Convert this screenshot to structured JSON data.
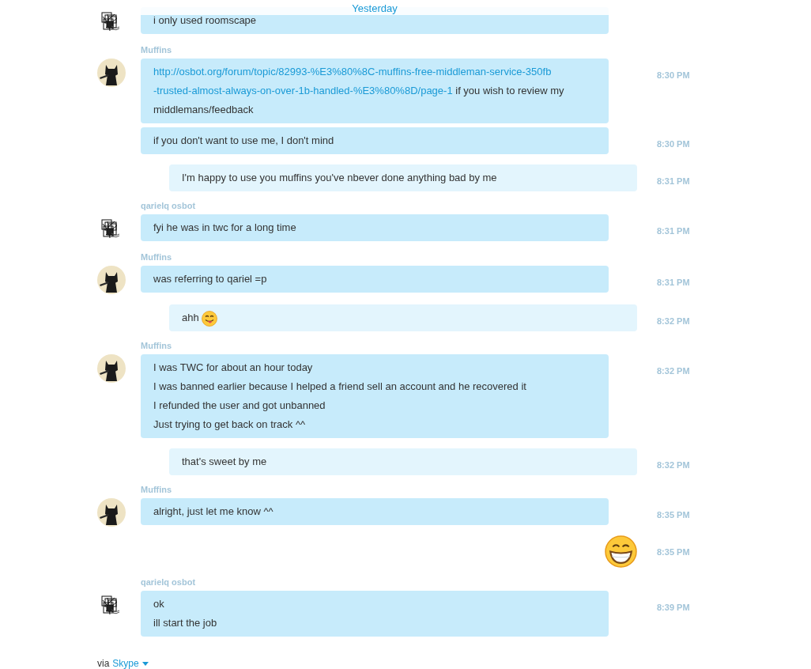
{
  "header": {
    "label": "Yesterday"
  },
  "groups": [
    {
      "kind": "incoming",
      "avatar": {
        "kind": "scribble"
      },
      "messages": [
        {
          "lines": [
            "i only used roomscape"
          ]
        }
      ]
    },
    {
      "kind": "incoming",
      "sender": "Muffins",
      "avatar": {
        "kind": "cat"
      },
      "messages": [
        {
          "lines": [
            [
              {
                "kind": "link",
                "text": "http://osbot.org/forum/topic/82993-%E3%80%8C-muffins-free-middleman-service-350fb"
              }
            ],
            [
              {
                "kind": "link",
                "text": "-trusted-almost-always-on-over-1b-handled-%E3%80%8D/page-1"
              },
              {
                "kind": "text",
                "text": " if you wish to review my"
              }
            ],
            "middlemans/feedback"
          ],
          "time": "8:30 PM"
        },
        {
          "lines": [
            "if you don't want to use me, I don't mind"
          ],
          "time": "8:30 PM"
        }
      ]
    },
    {
      "kind": "outgoing",
      "lines": [
        "I'm happy to use you muffins you've nbever done anything bad by me"
      ],
      "time": "8:31 PM"
    },
    {
      "kind": "incoming",
      "sender": "qarielq osbot",
      "avatar": {
        "kind": "scribble"
      },
      "messages": [
        {
          "lines": [
            "fyi he was in twc for a long time"
          ],
          "time": "8:31 PM"
        }
      ]
    },
    {
      "kind": "incoming",
      "sender": "Muffins",
      "avatar": {
        "kind": "cat"
      },
      "messages": [
        {
          "lines": [
            "was referring to qariel =p"
          ],
          "time": "8:31 PM"
        }
      ]
    },
    {
      "kind": "outgoing",
      "lines": [
        [
          {
            "kind": "text",
            "text": "ahh "
          },
          {
            "kind": "tongue_emoticon"
          }
        ]
      ],
      "time": "8:32 PM"
    },
    {
      "kind": "incoming",
      "sender": "Muffins",
      "avatar": {
        "kind": "cat"
      },
      "messages": [
        {
          "lines": [
            "I was TWC for about an hour today",
            "I was banned earlier because I helped a friend sell an account and he recovered it",
            "I refunded the user and got unbanned",
            "Just trying to get back on track ^^"
          ],
          "time": "8:32 PM"
        }
      ]
    },
    {
      "kind": "outgoing",
      "lines": [
        "that's sweet by me"
      ],
      "time": "8:32 PM"
    },
    {
      "kind": "incoming",
      "sender": "Muffins",
      "avatar": {
        "kind": "cat"
      },
      "messages": [
        {
          "lines": [
            "alright, just let me know ^^"
          ],
          "time": "8:35 PM"
        }
      ]
    },
    {
      "kind": "grin_emoticon",
      "time": "8:35 PM"
    },
    {
      "kind": "incoming",
      "sender": "qarielq osbot",
      "avatar": {
        "kind": "scribble"
      },
      "messages": [
        {
          "lines": [
            "ok",
            "ill start the job"
          ],
          "time": "8:39 PM"
        }
      ]
    }
  ],
  "footer": {
    "prefix": "via",
    "link": "Skype"
  }
}
